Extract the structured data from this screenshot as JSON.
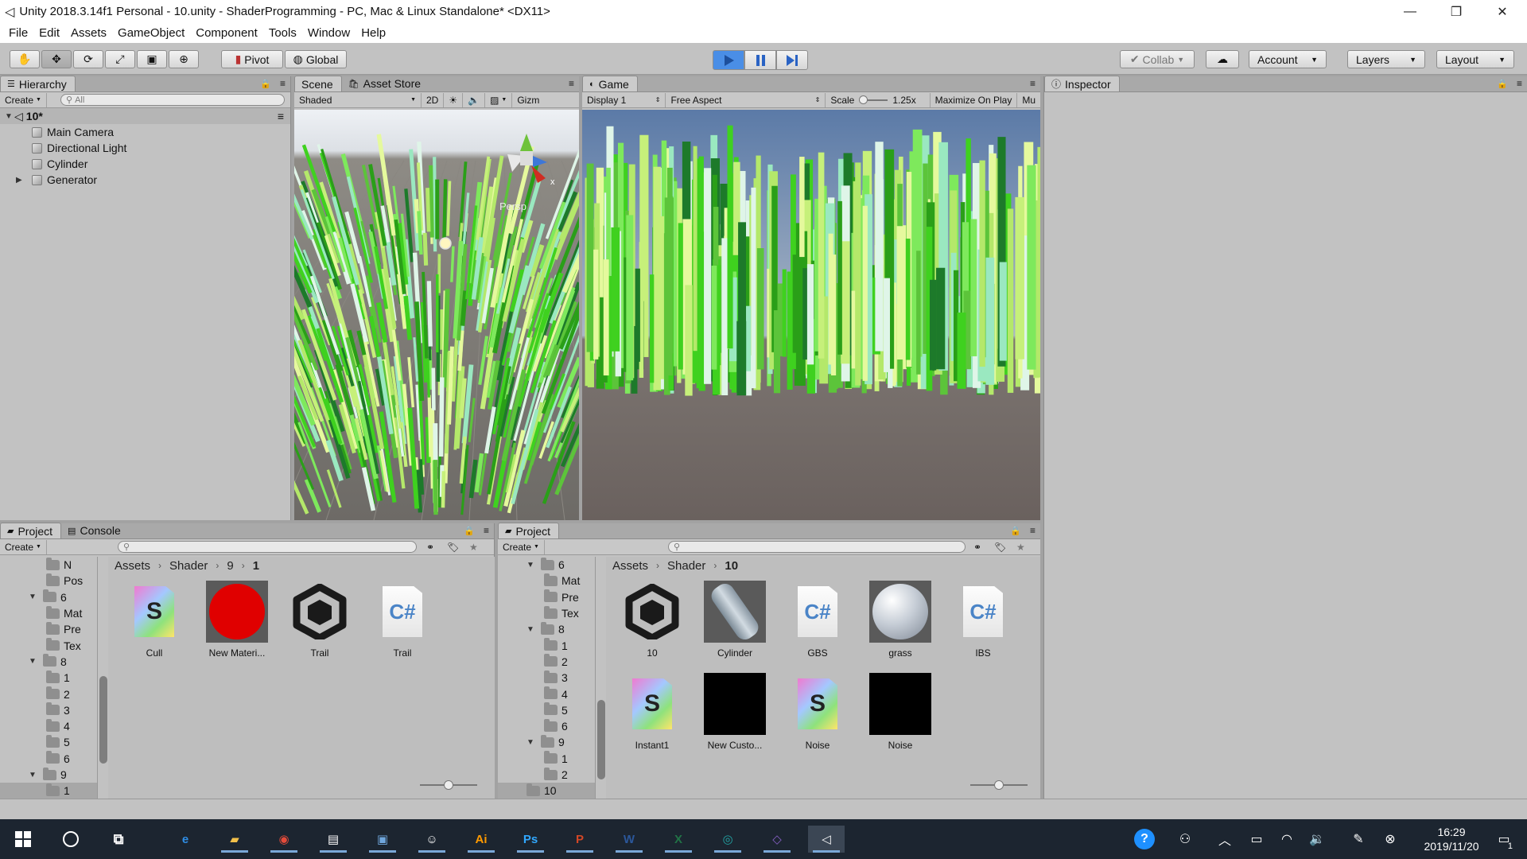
{
  "window": {
    "title": "Unity 2018.3.14f1 Personal - 10.unity - ShaderProgramming - PC, Mac & Linux Standalone* <DX11>",
    "minimize_glyph": "—",
    "maximize_glyph": "❐",
    "close_glyph": "✕"
  },
  "menu": [
    "File",
    "Edit",
    "Assets",
    "GameObject",
    "Component",
    "Tools",
    "Window",
    "Help"
  ],
  "toolbar": {
    "tools": [
      "hand-tool-icon",
      "move-tool-icon",
      "rotate-tool-icon",
      "scale-tool-icon",
      "rect-tool-icon",
      "transform-tool-icon"
    ],
    "pivot_label": "Pivot",
    "global_label": "Global",
    "play_active": true,
    "collab_label": "Collab",
    "account_label": "Account",
    "layers_label": "Layers",
    "layout_label": "Layout",
    "accent": "#4a8ee6"
  },
  "hierarchy": {
    "tab": "Hierarchy",
    "create_label": "Create",
    "search_placeholder": "All",
    "scene_name": "10*",
    "items": [
      "Main Camera",
      "Directional Light",
      "Cylinder",
      "Generator"
    ]
  },
  "scene": {
    "tab_scene": "Scene",
    "tab_asset_store": "Asset Store",
    "shading_mode": "Shaded",
    "mode_2d": "2D",
    "gizmos_label": "Gizm",
    "persp_label": "Persp",
    "axis_x": "x"
  },
  "game": {
    "tab": "Game",
    "display": "Display 1",
    "aspect": "Free Aspect",
    "scale_label": "Scale",
    "scale_value": "1.25x",
    "maximize_label": "Maximize On Play",
    "mute_label": "Mu"
  },
  "inspector": {
    "tab": "Inspector"
  },
  "project_left": {
    "tab_project": "Project",
    "tab_console": "Console",
    "create_label": "Create",
    "breadcrumb": [
      "Assets",
      "Shader",
      "9",
      "1"
    ],
    "tree": [
      {
        "label": "N",
        "depth": 2,
        "expanded": null
      },
      {
        "label": "Pos",
        "depth": 2,
        "expanded": null
      },
      {
        "label": "6",
        "depth": 1,
        "expanded": true
      },
      {
        "label": "Mat",
        "depth": 2,
        "expanded": null
      },
      {
        "label": "Pre",
        "depth": 2,
        "expanded": null
      },
      {
        "label": "Tex",
        "depth": 2,
        "expanded": null
      },
      {
        "label": "8",
        "depth": 1,
        "expanded": true
      },
      {
        "label": "1",
        "depth": 2,
        "expanded": null
      },
      {
        "label": "2",
        "depth": 2,
        "expanded": null
      },
      {
        "label": "3",
        "depth": 2,
        "expanded": null
      },
      {
        "label": "4",
        "depth": 2,
        "expanded": null
      },
      {
        "label": "5",
        "depth": 2,
        "expanded": null
      },
      {
        "label": "6",
        "depth": 2,
        "expanded": null
      },
      {
        "label": "9",
        "depth": 1,
        "expanded": true
      },
      {
        "label": "1",
        "depth": 2,
        "expanded": null,
        "selected": true
      }
    ],
    "assets": [
      {
        "label": "Cull",
        "kind": "shader"
      },
      {
        "label": "New Materi...",
        "kind": "material-red"
      },
      {
        "label": "Trail",
        "kind": "unity"
      },
      {
        "label": "Trail",
        "kind": "csharp"
      }
    ]
  },
  "project_right": {
    "tab_project": "Project",
    "create_label": "Create",
    "breadcrumb": [
      "Assets",
      "Shader",
      "10"
    ],
    "tree": [
      {
        "label": "6",
        "depth": 1,
        "expanded": true
      },
      {
        "label": "Mat",
        "depth": 2,
        "expanded": null
      },
      {
        "label": "Pre",
        "depth": 2,
        "expanded": null
      },
      {
        "label": "Tex",
        "depth": 2,
        "expanded": null
      },
      {
        "label": "8",
        "depth": 1,
        "expanded": true
      },
      {
        "label": "1",
        "depth": 2,
        "expanded": null
      },
      {
        "label": "2",
        "depth": 2,
        "expanded": null
      },
      {
        "label": "3",
        "depth": 2,
        "expanded": null
      },
      {
        "label": "4",
        "depth": 2,
        "expanded": null
      },
      {
        "label": "5",
        "depth": 2,
        "expanded": null
      },
      {
        "label": "6",
        "depth": 2,
        "expanded": null
      },
      {
        "label": "9",
        "depth": 1,
        "expanded": true
      },
      {
        "label": "1",
        "depth": 2,
        "expanded": null
      },
      {
        "label": "2",
        "depth": 2,
        "expanded": null
      },
      {
        "label": "10",
        "depth": 1,
        "expanded": null,
        "selected": true
      }
    ],
    "assets": [
      {
        "label": "10",
        "kind": "unity"
      },
      {
        "label": "Cylinder",
        "kind": "mesh"
      },
      {
        "label": "GBS",
        "kind": "csharp"
      },
      {
        "label": "grass",
        "kind": "sphere"
      },
      {
        "label": "IBS",
        "kind": "csharp"
      },
      {
        "label": "Instant1",
        "kind": "shader"
      },
      {
        "label": "New Custo...",
        "kind": "black"
      },
      {
        "label": "Noise",
        "kind": "shader"
      },
      {
        "label": "Noise",
        "kind": "black"
      }
    ]
  },
  "taskbar": {
    "apps": [
      {
        "name": "edge-icon",
        "glyph": "e",
        "color": "#2f8de4"
      },
      {
        "name": "explorer-icon",
        "glyph": "▰",
        "color": "#f2c04a"
      },
      {
        "name": "chrome-icon",
        "glyph": "◉",
        "color": "#e44b3a"
      },
      {
        "name": "store-icon",
        "glyph": "▤",
        "color": "#ffffff"
      },
      {
        "name": "mail-icon",
        "glyph": "▣",
        "color": "#6fa6dc"
      },
      {
        "name": "feedback-icon",
        "glyph": "☺",
        "color": "#ffffff"
      },
      {
        "name": "illustrator-icon",
        "glyph": "Ai",
        "color": "#ff9a00"
      },
      {
        "name": "photoshop-icon",
        "glyph": "Ps",
        "color": "#31a8ff"
      },
      {
        "name": "powerpoint-icon",
        "glyph": "P",
        "color": "#d24726"
      },
      {
        "name": "word-icon",
        "glyph": "W",
        "color": "#2b579a"
      },
      {
        "name": "excel-icon",
        "glyph": "X",
        "color": "#217346"
      },
      {
        "name": "gitkraken-icon",
        "glyph": "◎",
        "color": "#22a3a3"
      },
      {
        "name": "visual-studio-icon",
        "glyph": "◇",
        "color": "#865fc5"
      },
      {
        "name": "unity-icon",
        "glyph": "◁",
        "color": "#ffffff"
      }
    ],
    "time": "16:29",
    "date": "2019/11/20",
    "notification_count": "1"
  }
}
